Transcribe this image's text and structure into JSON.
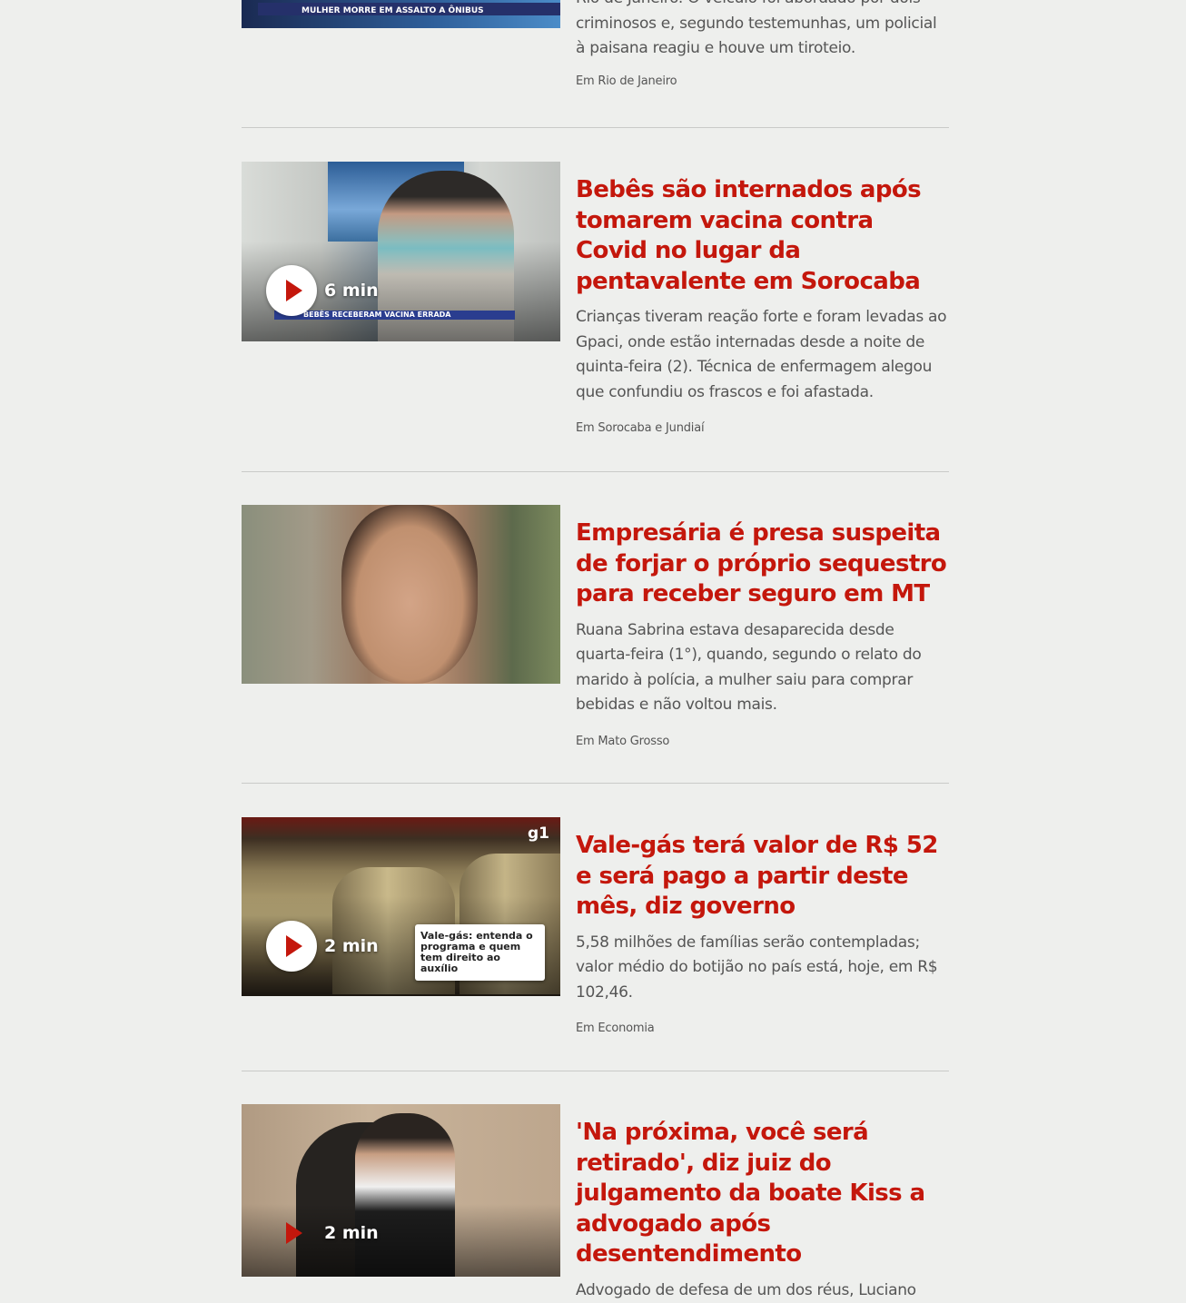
{
  "items": [
    {
      "summary_tail": "Rio de Janeiro. O veículo foi abordado por dois criminosos e, segundo testemunhas, um policial à paisana reagiu e houve um tiroteio.",
      "section": "Em Rio de Janeiro",
      "thumb_caption": "MULHER MORRE EM ASSALTO A ÔNIBUS"
    },
    {
      "title": "Bebês são internados após tomarem vacina contra Covid no lugar da pentavalente em Sorocaba",
      "summary": "Crianças tiveram reação forte e foram levadas ao Gpaci, onde estão internadas desde a noite de quinta-feira (2). Técnica de enfermagem alegou que confundiu os frascos e foi afastada.",
      "section": "Em Sorocaba e Jundiaí",
      "duration": "6 min",
      "thumb_caption": "BEBÊS RECEBERAM VACINA ERRADA"
    },
    {
      "title": "Empresária é presa suspeita de forjar o próprio sequestro para receber seguro em MT",
      "summary": "Ruana Sabrina estava desaparecida desde quarta-feira (1°), quando, segundo o relato do marido à polícia, a mulher saiu para comprar bebidas e não voltou mais.",
      "section": "Em Mato Grosso"
    },
    {
      "title": "Vale-gás terá valor de R$ 52 e será pago a partir deste mês, diz governo",
      "summary": "5,58 milhões de famílias serão contempladas; valor médio do botijão no país está, hoje, em R$ 102,46.",
      "section": "Em Economia",
      "duration": "2 min",
      "card_text": "Vale-gás: entenda o programa e quem tem direito ao auxílio",
      "brand": "g1"
    },
    {
      "title": "'Na próxima, você será retirado', diz juiz do julgamento da boate Kiss a advogado após desentendimento",
      "summary": "Advogado de defesa de um dos réus, Luciano",
      "duration": "2 min"
    }
  ],
  "colors": {
    "title": "#c4170c",
    "background": "#eeefed",
    "divider": "#c9cac8"
  },
  "icons": {
    "play": "play-icon"
  }
}
